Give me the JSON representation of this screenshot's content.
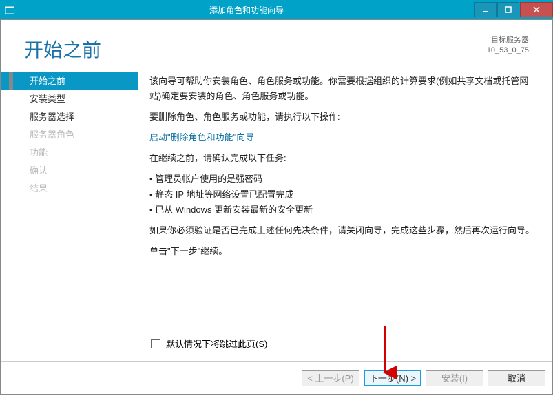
{
  "titlebar": {
    "title": "添加角色和功能向导"
  },
  "header": {
    "heading": "开始之前",
    "serverLabel": "目标服务器",
    "serverName": "10_53_0_75"
  },
  "nav": {
    "items": [
      {
        "label": "开始之前",
        "state": "active"
      },
      {
        "label": "安装类型",
        "state": "normal"
      },
      {
        "label": "服务器选择",
        "state": "normal"
      },
      {
        "label": "服务器角色",
        "state": "disabled"
      },
      {
        "label": "功能",
        "state": "disabled"
      },
      {
        "label": "确认",
        "state": "disabled"
      },
      {
        "label": "结果",
        "state": "disabled"
      }
    ]
  },
  "content": {
    "p1": "该向导可帮助你安装角色、角色服务或功能。你需要根据组织的计算要求(例如共享文档或托管网站)确定要安装的角色、角色服务或功能。",
    "p2": "要删除角色、角色服务或功能，请执行以下操作:",
    "link": "启动\"删除角色和功能\"向导",
    "p3": "在继续之前，请确认完成以下任务:",
    "bullets": [
      "管理员帐户使用的是强密码",
      "静态 IP 地址等网络设置已配置完成",
      "已从 Windows 更新安装最新的安全更新"
    ],
    "p4": "如果你必须验证是否已完成上述任何先决条件，请关闭向导，完成这些步骤，然后再次运行向导。",
    "p5": "单击\"下一步\"继续。"
  },
  "skip": {
    "label": "默认情况下将跳过此页(S)"
  },
  "footer": {
    "prev": "< 上一步(P)",
    "next": "下一步(N) >",
    "install": "安装(I)",
    "cancel": "取消"
  }
}
